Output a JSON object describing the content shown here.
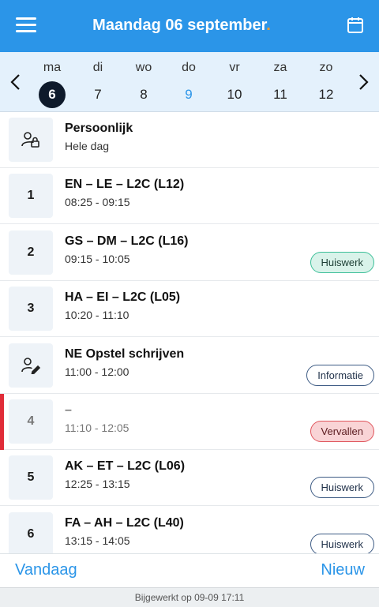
{
  "header": {
    "title": "Maandag 06 september",
    "title_dot": ".",
    "accent": "#2b95e8",
    "dot_color": "#ff9c2b"
  },
  "week": {
    "days": [
      {
        "name": "ma",
        "num": "6",
        "state": "selected"
      },
      {
        "name": "di",
        "num": "7",
        "state": ""
      },
      {
        "name": "wo",
        "num": "8",
        "state": ""
      },
      {
        "name": "do",
        "num": "9",
        "state": "today"
      },
      {
        "name": "vr",
        "num": "10",
        "state": ""
      },
      {
        "name": "za",
        "num": "11",
        "state": ""
      },
      {
        "name": "zo",
        "num": "12",
        "state": ""
      }
    ]
  },
  "schedule": [
    {
      "label_icon": "person-lock-icon",
      "title": "Persoonlijk",
      "time": "Hele dag"
    },
    {
      "label": "1",
      "title": "EN – LE – L2C (L12)",
      "time": "08:25 - 09:15"
    },
    {
      "label": "2",
      "title": "GS – DM – L2C (L16)",
      "time": "09:15 - 10:05",
      "badge": "Huiswerk"
    },
    {
      "label": "3",
      "title": "HA – EI – L2C (L05)",
      "time": "10:20 - 11:10"
    },
    {
      "label_icon": "person-edit-icon",
      "title": "NE Opstel schrijven",
      "time": "11:00 - 12:00",
      "badge": "Informatie"
    },
    {
      "label": "4",
      "title": "–",
      "time": "11:10 - 12:05",
      "badge": "Vervallen",
      "cancelled": true
    },
    {
      "label": "5",
      "title": "AK – ET – L2C (L06)",
      "time": "12:25 - 13:15",
      "badge": "Huiswerk"
    },
    {
      "label": "6",
      "title": "FA – AH – L2C (L40)",
      "time": "13:15 - 14:05",
      "badge": "Huiswerk"
    }
  ],
  "footer": {
    "today_label": "Vandaag",
    "new_label": "Nieuw"
  },
  "status": {
    "updated": "Bijgewerkt op 09-09 17:11"
  }
}
